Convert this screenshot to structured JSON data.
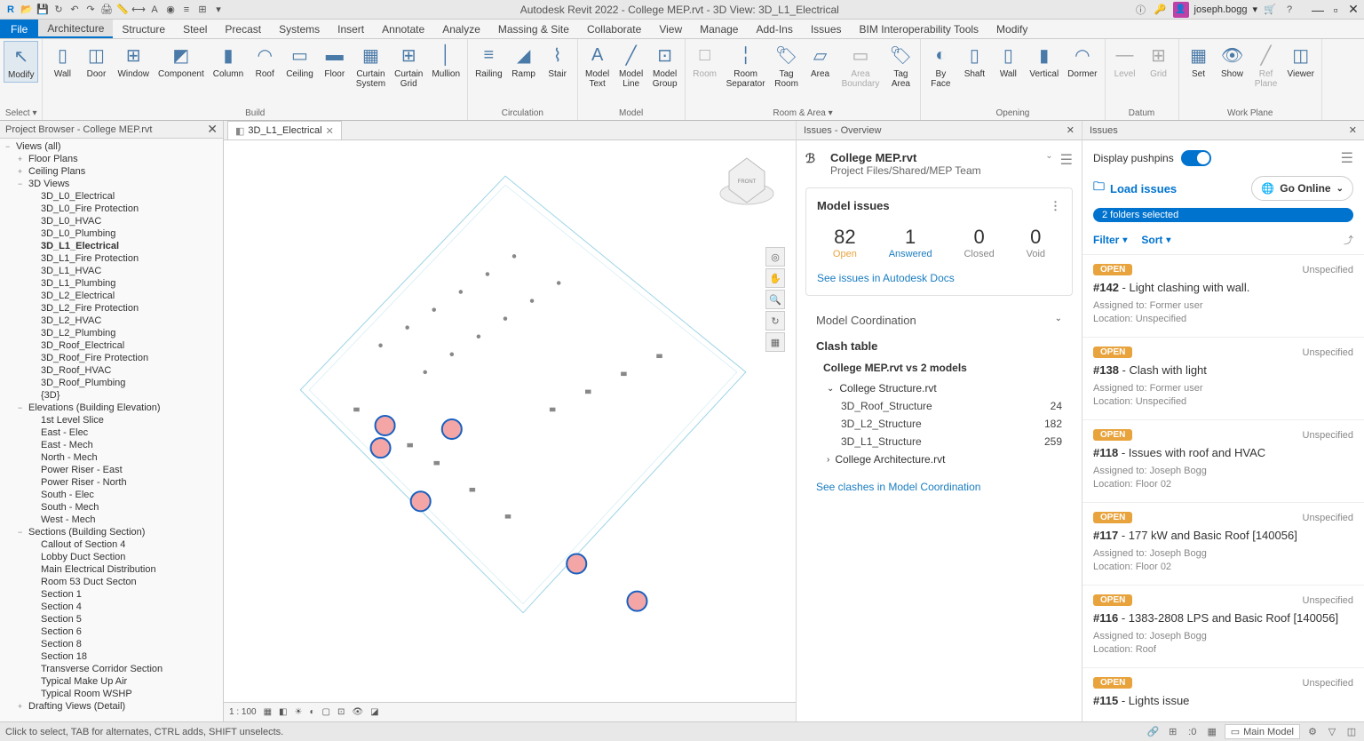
{
  "title": "Autodesk Revit 2022 - College MEP.rvt - 3D View: 3D_L1_Electrical",
  "user": "joseph.bogg",
  "ribbon": {
    "file": "File",
    "tabs": [
      "Architecture",
      "Structure",
      "Steel",
      "Precast",
      "Systems",
      "Insert",
      "Annotate",
      "Analyze",
      "Massing & Site",
      "Collaborate",
      "View",
      "Manage",
      "Add-Ins",
      "Issues",
      "BIM Interoperability Tools",
      "Modify"
    ],
    "activeTab": 0,
    "groups": {
      "modify": {
        "label": "Select ▾",
        "btn": "Modify"
      },
      "build": {
        "label": "Build",
        "btns": [
          "Wall",
          "Door",
          "Window",
          "Component",
          "Column",
          "Roof",
          "Ceiling",
          "Floor",
          "Curtain System",
          "Curtain Grid",
          "Mullion"
        ]
      },
      "circulation": {
        "label": "Circulation",
        "btns": [
          "Railing",
          "Ramp",
          "Stair"
        ]
      },
      "model": {
        "label": "Model",
        "btns": [
          "Model Text",
          "Model Line",
          "Model Group"
        ]
      },
      "roomarea": {
        "label": "Room & Area ▾",
        "btns": [
          "Room",
          "Room Separator",
          "Tag Room",
          "Area",
          "Area Boundary",
          "Tag Area"
        ]
      },
      "opening": {
        "label": "Opening",
        "btns": [
          "By Face",
          "Shaft",
          "Wall",
          "Vertical",
          "Dormer"
        ]
      },
      "datum": {
        "label": "Datum",
        "btns": [
          "Level",
          "Grid"
        ]
      },
      "workplane": {
        "label": "Work Plane",
        "btns": [
          "Set",
          "Show",
          "Ref Plane",
          "Viewer"
        ]
      }
    }
  },
  "projectBrowser": {
    "title": "Project Browser - College MEP.rvt",
    "root": "Views (all)",
    "groups": [
      {
        "label": "Floor Plans",
        "toggle": "+"
      },
      {
        "label": "Ceiling Plans",
        "toggle": "+"
      },
      {
        "label": "3D Views",
        "toggle": "−",
        "children": [
          "3D_L0_Electrical",
          "3D_L0_Fire Protection",
          "3D_L0_HVAC",
          "3D_L0_Plumbing",
          {
            "label": "3D_L1_Electrical",
            "bold": true
          },
          "3D_L1_Fire Protection",
          "3D_L1_HVAC",
          "3D_L1_Plumbing",
          "3D_L2_Electrical",
          "3D_L2_Fire Protection",
          "3D_L2_HVAC",
          "3D_L2_Plumbing",
          "3D_Roof_Electrical",
          "3D_Roof_Fire Protection",
          "3D_Roof_HVAC",
          "3D_Roof_Plumbing",
          "{3D}"
        ]
      },
      {
        "label": "Elevations (Building Elevation)",
        "toggle": "−",
        "children": [
          "1st Level Slice",
          "East - Elec",
          "East - Mech",
          "North - Mech",
          "Power Riser - East",
          "Power Riser - North",
          "South - Elec",
          "South - Mech",
          "West - Mech"
        ]
      },
      {
        "label": "Sections (Building Section)",
        "toggle": "−",
        "children": [
          "Callout of Section 4",
          "Lobby Duct Section",
          "Main Electrical Distribution",
          "Room 53 Duct Secton",
          "Section 1",
          "Section 4",
          "Section 5",
          "Section 6",
          "Section 8",
          "Section 18",
          "Transverse Corridor Section",
          "Typical Make Up Air",
          "Typical Room WSHP"
        ]
      },
      {
        "label": "Drafting Views (Detail)",
        "toggle": "+"
      }
    ]
  },
  "viewTab": {
    "name": "3D_L1_Electrical"
  },
  "viewScale": "1 : 100",
  "issuesOverview": {
    "title": "Issues - Overview",
    "project": "College MEP.rvt",
    "path": "Project Files/Shared/MEP Team",
    "modelIssuesTitle": "Model issues",
    "stats": {
      "open": "82",
      "answered": "1",
      "closed": "0",
      "void": "0"
    },
    "statLabels": {
      "open": "Open",
      "answered": "Answered",
      "closed": "Closed",
      "void": "Void"
    },
    "docsLink": "See issues in Autodesk Docs",
    "coordTitle": "Model Coordination",
    "clashTitle": "Clash table",
    "clashSub": "College MEP.rvt vs 2 models",
    "clashGroups": [
      {
        "name": "College Structure.rvt",
        "expanded": true,
        "rows": [
          {
            "name": "3D_Roof_Structure",
            "count": "24"
          },
          {
            "name": "3D_L2_Structure",
            "count": "182"
          },
          {
            "name": "3D_L1_Structure",
            "count": "259"
          }
        ]
      },
      {
        "name": "College Architecture.rvt",
        "expanded": false
      }
    ],
    "clashLink": "See clashes in Model Coordination"
  },
  "issuesPanel": {
    "title": "Issues",
    "pushpinLabel": "Display pushpins",
    "loadIssues": "Load issues",
    "goOnline": "Go Online",
    "foldersSelected": "2 folders selected",
    "filter": "Filter",
    "sort": "Sort",
    "unspecified": "Unspecified",
    "openBadge": "OPEN",
    "assignedPrefix": "Assigned to: ",
    "locationPrefix": "Location: ",
    "issues": [
      {
        "num": "#142",
        "title": "Light clashing with wall.",
        "assignee": "Former user",
        "location": "Unspecified"
      },
      {
        "num": "#138",
        "title": "Clash with light",
        "assignee": "Former user",
        "location": "Unspecified"
      },
      {
        "num": "#118",
        "title": "Issues with roof and HVAC",
        "assignee": "Joseph Bogg",
        "location": "Floor 02"
      },
      {
        "num": "#117",
        "title": "177 kW and Basic Roof [140056]",
        "assignee": "Joseph Bogg",
        "location": "Floor 02"
      },
      {
        "num": "#116",
        "title": "1383-2808 LPS and Basic Roof [140056]",
        "assignee": "Joseph Bogg",
        "location": "Roof"
      },
      {
        "num": "#115",
        "title": "Lights issue",
        "assignee": "",
        "location": ""
      }
    ]
  },
  "statusBar": {
    "hint": "Click to select, TAB for alternates, CTRL adds, SHIFT unselects.",
    "mainModel": "Main Model"
  }
}
